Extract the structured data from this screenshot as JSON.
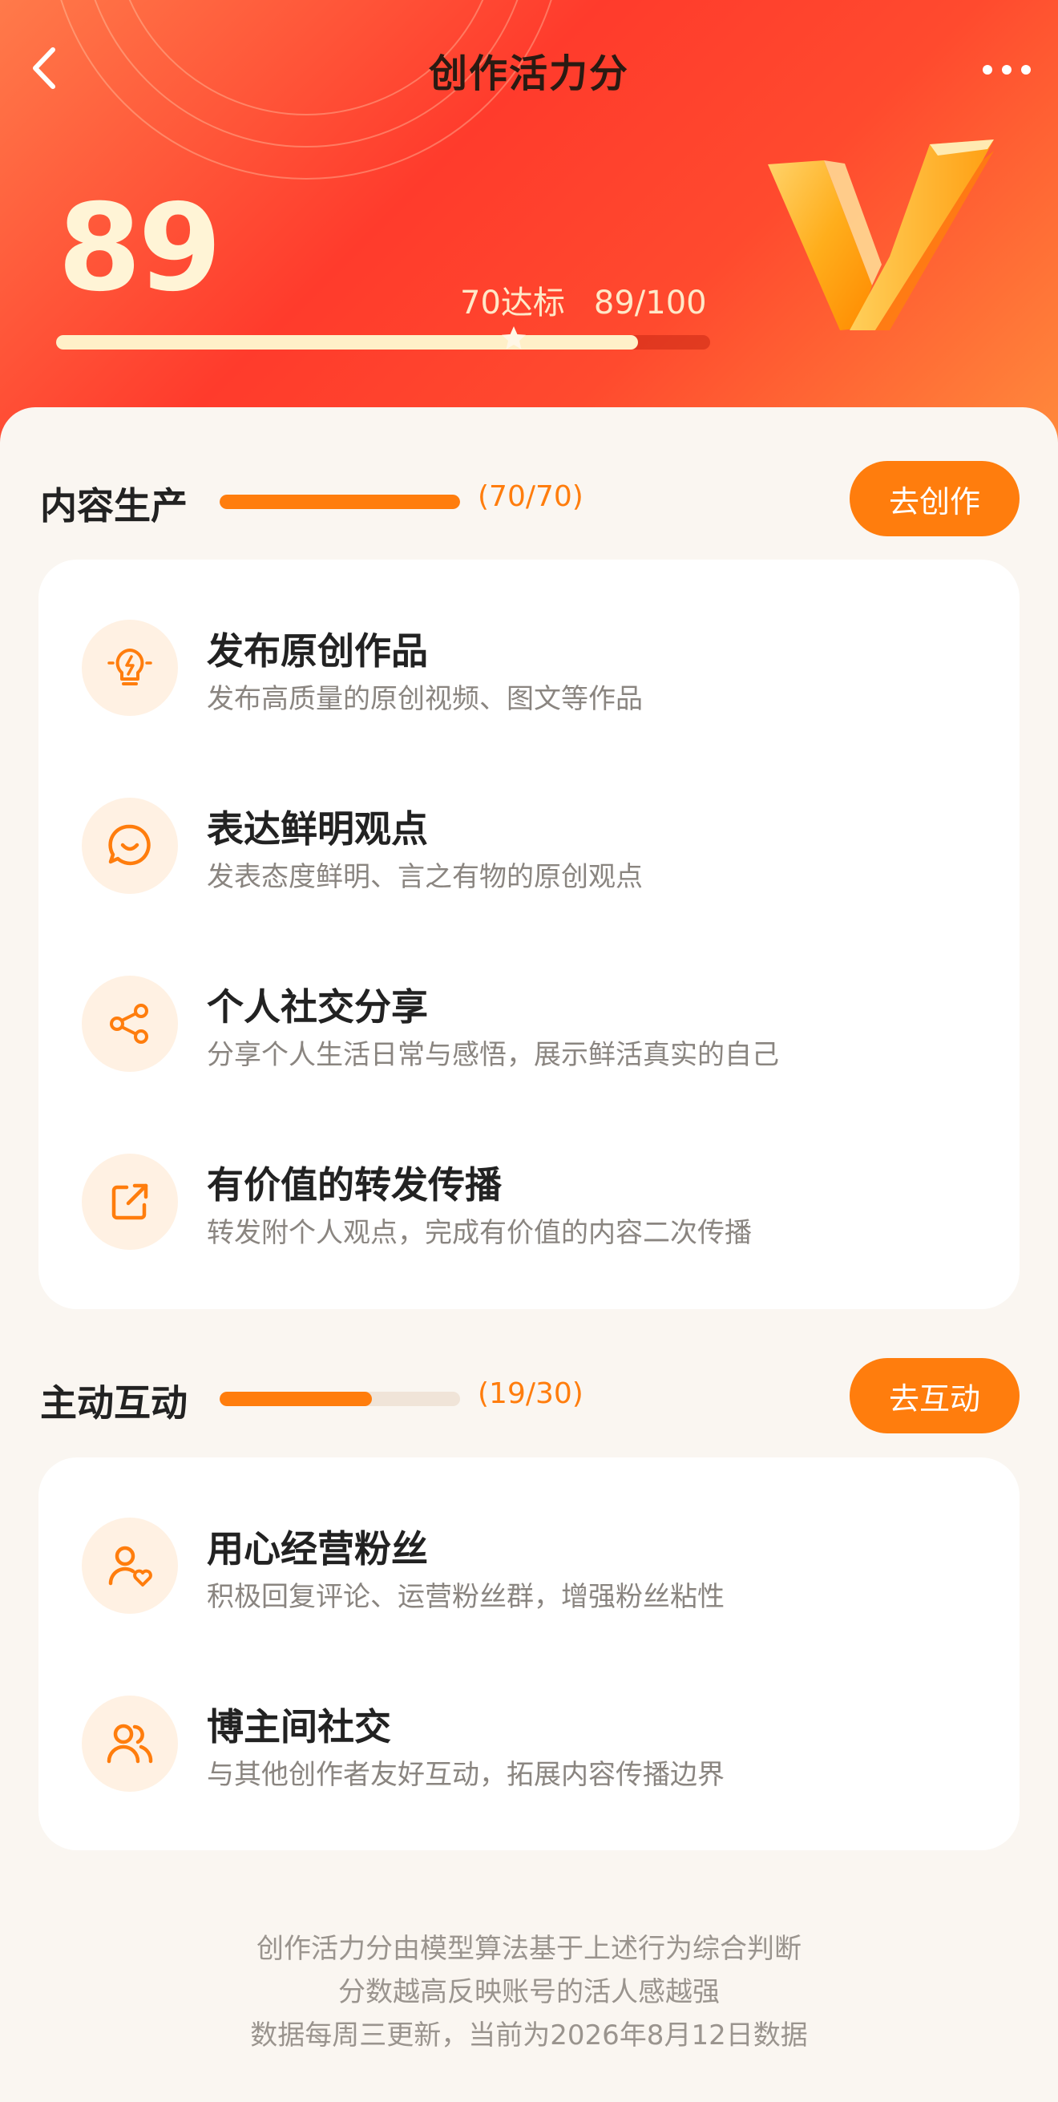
{
  "header": {
    "title": "创作活力分",
    "back_icon": "back-arrow-icon",
    "more_icon": "more-dots-icon"
  },
  "score": {
    "value": "89",
    "threshold_label": "70达标",
    "progress_text": "89/100",
    "current": 89,
    "max": 100,
    "threshold": 70
  },
  "colors": {
    "accent": "#ff7d0d",
    "hero_red": "#ff3b2c",
    "score_cream": "#fff4d6"
  },
  "sections": [
    {
      "title": "内容生产",
      "progress_text": "(70/70)",
      "current": 70,
      "max": 70,
      "button_label": "去创作",
      "items": [
        {
          "icon": "lightbulb-icon",
          "title": "发布原创作品",
          "desc": "发布高质量的原创视频、图文等作品"
        },
        {
          "icon": "smile-chat-icon",
          "title": "表达鲜明观点",
          "desc": "发表态度鲜明、言之有物的原创观点"
        },
        {
          "icon": "share-icon",
          "title": "个人社交分享",
          "desc": "分享个人生活日常与感悟，展示鲜活真实的自己"
        },
        {
          "icon": "forward-icon",
          "title": "有价值的转发传播",
          "desc": "转发附个人观点，完成有价值的内容二次传播"
        }
      ]
    },
    {
      "title": "主动互动",
      "progress_text": "(19/30)",
      "current": 19,
      "max": 30,
      "button_label": "去互动",
      "items": [
        {
          "icon": "user-heart-icon",
          "title": "用心经营粉丝",
          "desc": "积极回复评论、运营粉丝群，增强粉丝粘性"
        },
        {
          "icon": "users-icon",
          "title": "博主间社交",
          "desc": "与其他创作者友好互动，拓展内容传播边界"
        }
      ]
    }
  ],
  "footer": {
    "line1": "创作活力分由模型算法基于上述行为综合判断",
    "line2": "分数越高反映账号的活人感越强",
    "line3": "数据每周三更新，当前为2026年8月12日数据"
  }
}
